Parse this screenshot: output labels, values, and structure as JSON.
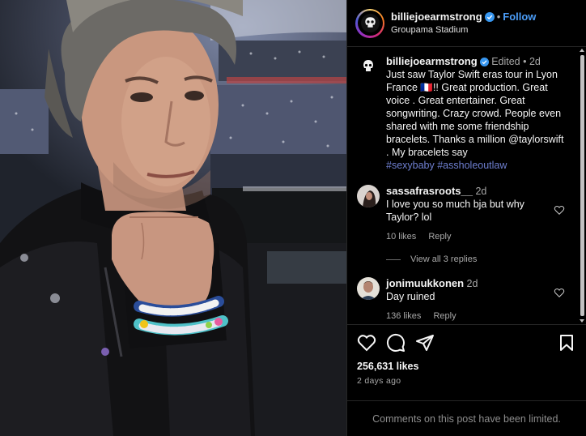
{
  "header": {
    "username": "billiejoearmstrong",
    "follow_label": "Follow",
    "separator": "•",
    "location": "Groupama Stadium"
  },
  "caption": {
    "username": "billiejoearmstrong",
    "edited": "Edited",
    "time": "2d",
    "text": "Just saw Taylor Swift eras tour in Lyon France 🇫🇷!! Great production. Great voice . Great entertainer. Great songwriting. Crazy crowd. People even shared with me some friendship bracelets. Thanks a million",
    "mention": "@taylorswift",
    "text_after": ". My bracelets say",
    "hashtags": "#sexybaby #assholeoutlaw"
  },
  "comments": [
    {
      "username": "sassafrasroots__",
      "time": "2d",
      "text": "I love you so much bja but why Taylor? lol",
      "likes": "10 likes",
      "reply_label": "Reply",
      "view_replies": "View all 3 replies"
    },
    {
      "username": "jonimuukkonen",
      "time": "2d",
      "text": "Day ruined",
      "likes": "136 likes",
      "reply_label": "Reply"
    }
  ],
  "post": {
    "likes": "256,631 likes",
    "ago": "2 days ago",
    "comments_limited": "Comments on this post have been limited."
  },
  "bracelets": {
    "top": "SEXY BABY",
    "bottom": "SEXY BABY"
  },
  "colors": {
    "follow": "#4b9df8",
    "hashtag": "#6e7fd0",
    "verified": "#3897f0",
    "secondary_text": "#a8a8a8"
  }
}
